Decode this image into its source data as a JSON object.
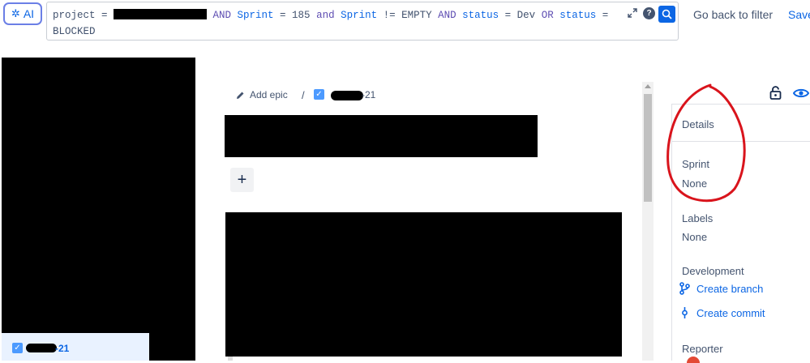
{
  "search": {
    "ai_label": "AI",
    "jql_line1": {
      "p1": "project = ",
      "p2": " AND ",
      "p3": "Sprint",
      "p4": " = 185 ",
      "p5": "and",
      "p6": " ",
      "p7": "Sprint",
      "p8": " != EMPTY ",
      "p9": "AND",
      "p10": " ",
      "p11": "status",
      "p12": " = Dev ",
      "p13": "OR",
      "p14": " ",
      "p15": "status",
      "p16": " ="
    },
    "jql_line2": "BLOCKED",
    "help_label": "?"
  },
  "header": {
    "go_back_label": "Go back to filter",
    "save_label": "Save"
  },
  "issue_list": {
    "selected_key_suffix": "-21"
  },
  "issue": {
    "add_epic_label": "Add epic",
    "breadcrumb_separator": "/",
    "key_suffix": "-21",
    "add_button_label": "+"
  },
  "details": {
    "heading": "Details",
    "sprint_label": "Sprint",
    "sprint_value": "None",
    "labels_label": "Labels",
    "labels_value": "None",
    "development_label": "Development",
    "create_branch_label": "Create branch",
    "create_commit_label": "Create commit",
    "reporter_label": "Reporter"
  },
  "colors": {
    "accent": "#0c66e4",
    "annotation": "#d9141c"
  },
  "icons": [
    "ai-sparkle-icon",
    "expand-icon",
    "help-icon",
    "search-icon",
    "pencil-icon",
    "checkbox-icon",
    "plus-icon",
    "lock-icon",
    "eye-icon",
    "branch-icon",
    "commit-icon"
  ]
}
